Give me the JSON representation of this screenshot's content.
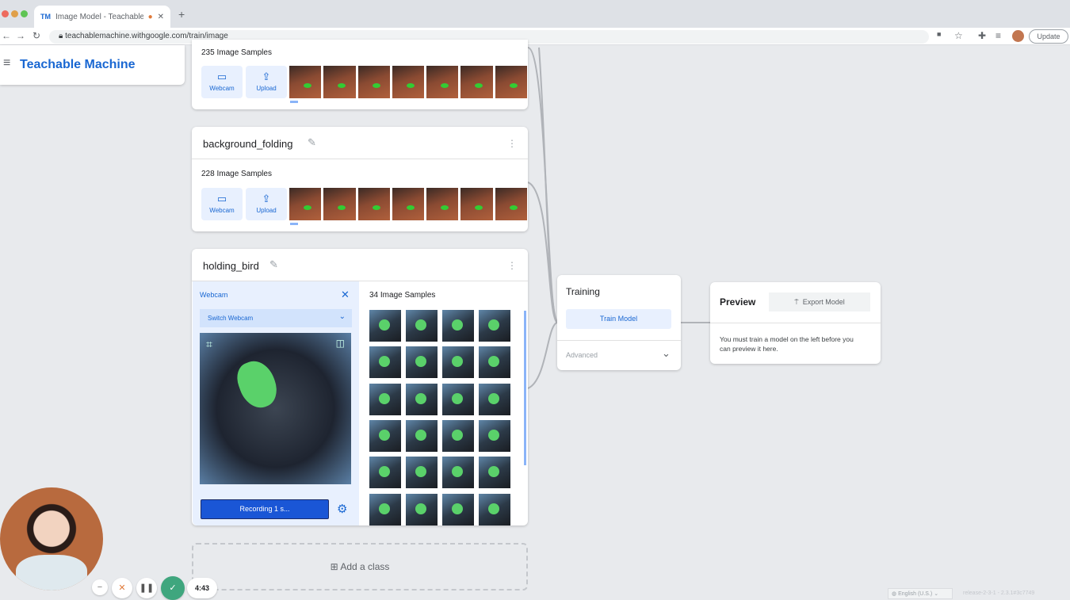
{
  "browser": {
    "tab_title": "Image Model - Teachable M",
    "tab_favicon": "TM",
    "url": "teachablemachine.withgoogle.com/train/image",
    "update_label": "Update"
  },
  "app": {
    "title": "Teachable Machine"
  },
  "classes": [
    {
      "name": "",
      "samples": "235 Image Samples",
      "webcam": "Webcam",
      "upload": "Upload"
    },
    {
      "name": "background_folding",
      "samples": "228 Image Samples",
      "webcam": "Webcam",
      "upload": "Upload"
    },
    {
      "name": "holding_bird",
      "samples": "34 Image Samples",
      "webcam_panel": {
        "title": "Webcam",
        "switch": "Switch Webcam",
        "recording": "Recording 1 s..."
      }
    }
  ],
  "add_class": "Add a class",
  "training": {
    "title": "Training",
    "train_button": "Train Model",
    "advanced": "Advanced"
  },
  "preview": {
    "title": "Preview",
    "export_button": "Export Model",
    "message": "You must train a model on the left before you can preview it here."
  },
  "footer": {
    "language": "English (U.S.)",
    "release": "release-2-3-1 - 2.3.1#3c7749"
  },
  "recorder": {
    "time": "4:43"
  }
}
